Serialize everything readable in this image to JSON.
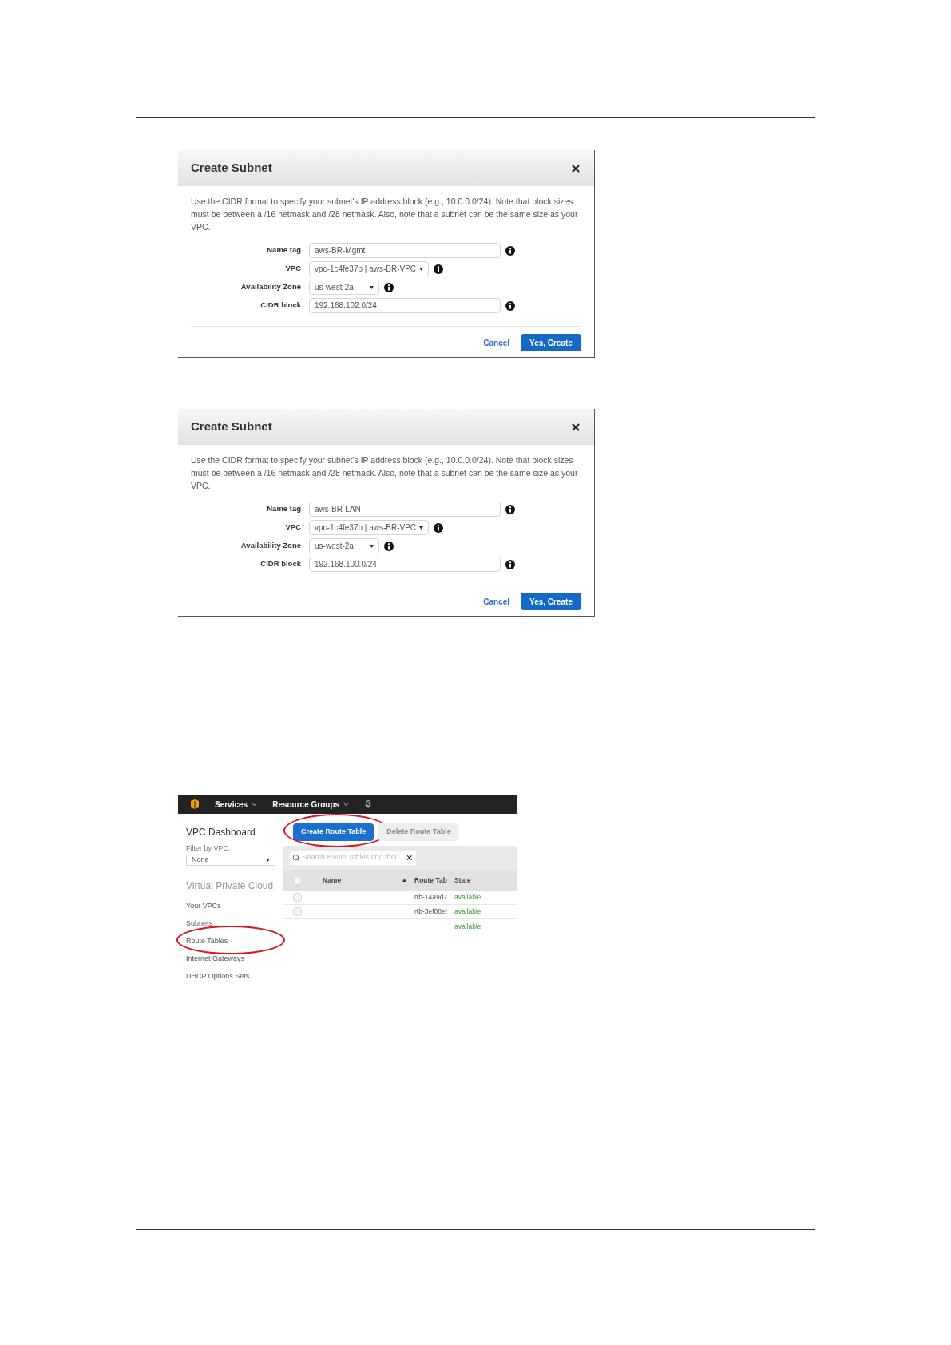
{
  "dialogs": [
    {
      "title": "Create Subnet",
      "description": "Use the CIDR format to specify your subnet's IP address block (e.g., 10.0.0.0/24). Note that block sizes must be between a /16 netmask and /28 netmask. Also, note that a subnet can be the same size as your VPC.",
      "fields": [
        {
          "label": "Name tag",
          "kind": "text",
          "value": "aws-BR-Mgmt"
        },
        {
          "label": "VPC",
          "kind": "select",
          "value": "vpc-1c4fe37b | aws-BR-VPC"
        },
        {
          "label": "Availability Zone",
          "kind": "select",
          "value": "us-west-2a"
        },
        {
          "label": "CIDR block",
          "kind": "text",
          "value": "192.168.102.0/24"
        }
      ],
      "cancel": "Cancel",
      "submit": "Yes, Create"
    },
    {
      "title": "Create Subnet",
      "description": "Use the CIDR format to specify your subnet's IP address block (e.g., 10.0.0.0/24). Note that block sizes must be between a /16 netmask and /28 netmask. Also, note that a subnet can be the same size as your VPC.",
      "fields": [
        {
          "label": "Name tag",
          "kind": "text",
          "value": "aws-BR-LAN"
        },
        {
          "label": "VPC",
          "kind": "select",
          "value": "vpc-1c4fe37b | aws-BR-VPC"
        },
        {
          "label": "Availability Zone",
          "kind": "select",
          "value": "us-west-2a"
        },
        {
          "label": "CIDR block",
          "kind": "text",
          "value": "192.168.100.0/24"
        }
      ],
      "cancel": "Cancel",
      "submit": "Yes, Create"
    }
  ],
  "console": {
    "nav": [
      "Services",
      "Resource Groups"
    ],
    "sidebar": {
      "title": "VPC Dashboard",
      "filter_label": "Filter by VPC:",
      "filter_value": "None",
      "section": "Virtual Private Cloud",
      "items": [
        {
          "label": "Your VPCs",
          "circled": false
        },
        {
          "label": "Subnets",
          "circled": false
        },
        {
          "label": "Route Tables",
          "circled": true
        },
        {
          "label": "Internet Gateways",
          "circled": false
        },
        {
          "label": "DHCP Options Sets",
          "circled": false
        }
      ]
    },
    "buttons": [
      {
        "label": "Create Route Table",
        "disabled": false,
        "circled": true
      },
      {
        "label": "Delete Route Table",
        "disabled": true,
        "circled": false
      }
    ],
    "search": {
      "placeholder": "Search Route Tables and thei"
    },
    "columns": [
      "Name",
      "Route Tab",
      "State"
    ],
    "header_checked": false,
    "rows": [
      {
        "kind": "checkbox",
        "checked": false,
        "route_table": "rtb-14a9d7",
        "state": "available"
      },
      {
        "kind": "checkbox",
        "checked": false,
        "route_table": "rtb-3ef08e!",
        "state": "available"
      },
      {
        "kind": "plain",
        "state": "available"
      }
    ]
  }
}
